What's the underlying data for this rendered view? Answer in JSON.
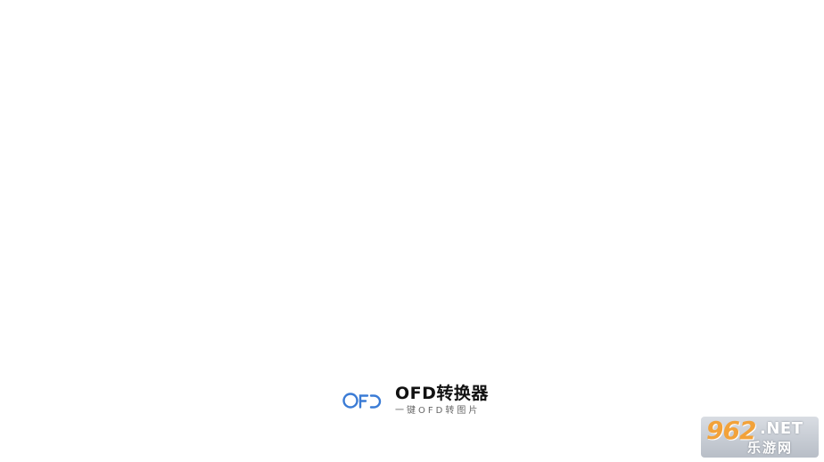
{
  "splash": {
    "app_name": "OFD转换器",
    "tagline": "一键OFD转图片",
    "logo_text": "OFD",
    "logo_color": "#3a7bd5"
  },
  "watermark": {
    "number": "962",
    "suffix": ".NET",
    "site_name": "乐游网",
    "accent_color": "#f2a23a"
  }
}
